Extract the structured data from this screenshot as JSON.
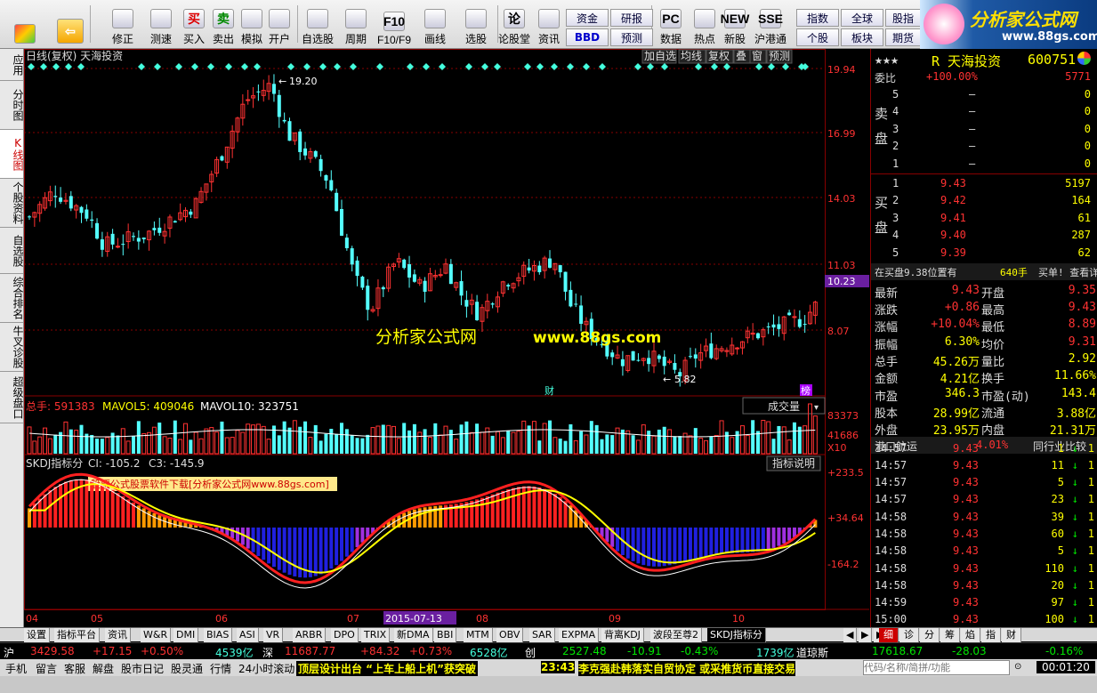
{
  "toolbar": {
    "buttons": [
      {
        "label": "修正",
        "icon": "up-arrow-icon"
      },
      {
        "label": "测速",
        "icon": "clock-icon"
      },
      {
        "label": "买入",
        "icon": "buy-icon",
        "glyph": "买"
      },
      {
        "label": "卖出",
        "icon": "sell-icon",
        "glyph": "卖"
      },
      {
        "label": "模拟",
        "icon": "hammer-icon"
      },
      {
        "label": "开户",
        "icon": "lock-icon"
      },
      {
        "label": "自选股",
        "icon": "star-icon"
      },
      {
        "label": "周期",
        "icon": "period-icon"
      },
      {
        "label": "F10/F9",
        "icon": "f10-icon",
        "glyph": "F10"
      },
      {
        "label": "画线",
        "icon": "pencil-icon"
      },
      {
        "label": "选股",
        "icon": "chart-icon"
      },
      {
        "label": "论股堂",
        "icon": "forum-icon",
        "glyph": "论"
      },
      {
        "label": "资讯",
        "icon": "news-icon"
      },
      {
        "label": "数据",
        "icon": "pc-icon",
        "glyph": "PC"
      },
      {
        "label": "热点",
        "icon": "hot-icon"
      },
      {
        "label": "新股",
        "icon": "newstock-icon",
        "glyph": "NEW"
      },
      {
        "label": "沪港通",
        "icon": "hk-icon",
        "glyph": "SSE"
      }
    ],
    "small_buttons": [
      "资金",
      "研报",
      "BBD",
      "预测",
      "指数",
      "全球",
      "股指",
      "个股",
      "板块",
      "期货"
    ],
    "logo_text": "分析家公式网",
    "logo_url": "www.88gs.com"
  },
  "left_nav": [
    "应用",
    "分时图",
    "K线图",
    "个股资料",
    "自选股",
    "综合排名",
    "牛叉诊股",
    "超级盘口"
  ],
  "chart": {
    "header_left": "日线(复权)  天海投资",
    "header_buttons": [
      "加自选",
      "均线",
      "复权",
      "叠",
      "窗",
      "预测"
    ],
    "price_axis": [
      "19.94",
      "16.99",
      "14.03",
      "11.03",
      "8.07"
    ],
    "current_price_tag": "10.23",
    "high_label": "19.20",
    "low_label": "5.82",
    "marker_cai": "财",
    "marker_bang": "榜",
    "watermark_cn": "分析家公式网",
    "watermark_url": "www.88gs.com",
    "volume_header": {
      "zongshou": "总手: 591383",
      "mavol5": "MAVOL5: 409046",
      "mavol10": "MAVOL10: 323751"
    },
    "volume_dropdown": "成交量",
    "volume_axis": [
      "83373",
      "41686",
      "X10"
    ],
    "indicator_header": {
      "name": "SKDJ指标分",
      "ci": "CI: -105.2",
      "c3": "C3: -145.9"
    },
    "indicator_button": "指标说明",
    "indicator_banner": "股票公式股票软件下载[分析家公式网www.88gs.com]",
    "indicator_axis": [
      "+233.5",
      "+34.64",
      "-164.2"
    ],
    "x_axis": [
      "04",
      "05",
      "06",
      "07",
      "08",
      "09",
      "10"
    ],
    "date_tag": "2015-07-13",
    "colors": {
      "up": "#ff3232",
      "down": "#54ffff",
      "ma": "#ffff00",
      "bg": "#000000"
    }
  },
  "quote": {
    "stars": "★★★",
    "code_name": "R 天海投资",
    "code": "600751",
    "weibi_label": "委比",
    "weibi_value": "+100.00%",
    "weibi_num": "5771",
    "sell_label": [
      "卖",
      "盘"
    ],
    "buy_label": [
      "买",
      "盘"
    ],
    "sells": [
      {
        "lvl": "5",
        "price": "–",
        "vol": "0"
      },
      {
        "lvl": "4",
        "price": "–",
        "vol": "0"
      },
      {
        "lvl": "3",
        "price": "–",
        "vol": "0"
      },
      {
        "lvl": "2",
        "price": "–",
        "vol": "0"
      },
      {
        "lvl": "1",
        "price": "–",
        "vol": "0"
      }
    ],
    "buys": [
      {
        "lvl": "1",
        "price": "9.43",
        "vol": "5197"
      },
      {
        "lvl": "2",
        "price": "9.42",
        "vol": "164"
      },
      {
        "lvl": "3",
        "price": "9.41",
        "vol": "61"
      },
      {
        "lvl": "4",
        "price": "9.40",
        "vol": "287"
      },
      {
        "lvl": "5",
        "price": "9.39",
        "vol": "62"
      }
    ],
    "queue_info": "在买盘9.38位置有",
    "queue_vol": "640手",
    "queue_link": "买单! 查看详细",
    "stats": [
      [
        "最新",
        "9.43",
        "开盘",
        "9.35"
      ],
      [
        "涨跌",
        "+0.86",
        "最高",
        "9.43"
      ],
      [
        "涨幅",
        "+10.04%",
        "最低",
        "8.89"
      ],
      [
        "振幅",
        "6.30%",
        "均价",
        "9.31"
      ],
      [
        "总手",
        "45.26万",
        "量比",
        "2.92"
      ],
      [
        "金额",
        "4.21亿",
        "换手",
        "11.66%"
      ],
      [
        "市盈",
        "346.3",
        "市盈(动)",
        "143.4"
      ],
      [
        "股本",
        "28.99亿",
        "流通",
        "3.88亿"
      ],
      [
        "外盘",
        "23.95万",
        "内盘",
        "21.31万"
      ]
    ],
    "sector_name": "港口航运",
    "sector_pct": "4.01%",
    "sector_compare": "同行业比较",
    "ticks": [
      [
        "14:57",
        "9.43",
        "1"
      ],
      [
        "14:57",
        "9.43",
        "11"
      ],
      [
        "14:57",
        "9.43",
        "5"
      ],
      [
        "14:57",
        "9.43",
        "23"
      ],
      [
        "14:58",
        "9.43",
        "39"
      ],
      [
        "14:58",
        "9.43",
        "60"
      ],
      [
        "14:58",
        "9.43",
        "5"
      ],
      [
        "14:58",
        "9.43",
        "110"
      ],
      [
        "14:58",
        "9.43",
        "20"
      ],
      [
        "14:59",
        "9.43",
        "97"
      ],
      [
        "15:00",
        "9.43",
        "100"
      ]
    ],
    "tick_count": "1",
    "right_tabs": [
      "细",
      "诊",
      "分",
      "筹",
      "焰",
      "指",
      "财"
    ]
  },
  "bottom_tabs": [
    "设置",
    "指标平台",
    "资讯",
    "W&R",
    "DMI",
    "BIAS",
    "ASI",
    "VR",
    "ARBR",
    "DPO",
    "TRIX",
    "新DMA",
    "BBI",
    "MTM",
    "OBV",
    "SAR",
    "EXPMA",
    "背离KDJ",
    "波段至尊2",
    "SKDJ指标分"
  ],
  "status": {
    "sh_label": "沪",
    "sh_index": "3429.58",
    "sh_chg": "+17.15",
    "sh_pct": "+0.50%",
    "sh_amt": "4539亿",
    "sz_label": "深",
    "sz_index": "11687.77",
    "sz_chg": "+84.32",
    "sz_pct": "+0.73%",
    "sz_amt": "6528亿",
    "cy_label": "创",
    "cy_index": "2527.48",
    "cy_chg": "-10.91",
    "cy_pct": "-0.43%",
    "cy_amt": "1739亿",
    "dj_label": "道琼斯",
    "dj_index": "17618.67",
    "dj_chg": "-28.03",
    "dj_pct": "-0.16%"
  },
  "statusbar": {
    "items": [
      "手机",
      "留言",
      "客服",
      "解盘",
      "股市日记",
      "股灵通",
      "行情",
      "24小时滚动"
    ],
    "news1": "顶层设计出台 “上车上船上机”获突破",
    "news_time": "23:43",
    "news2": "李克强赴韩落实自贸协定 或采推货币直接交易",
    "search_placeholder": "代码/名称/简拼/功能",
    "clock": "00:01:20"
  }
}
